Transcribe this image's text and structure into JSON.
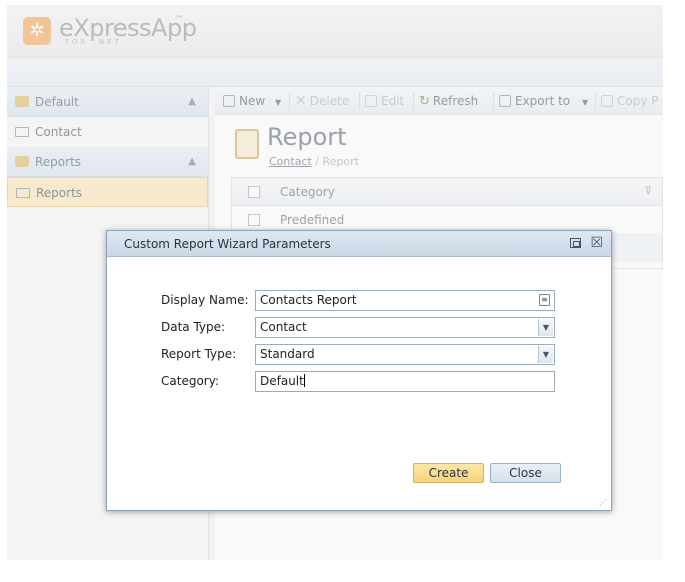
{
  "app": {
    "logo_name": "eXpressApp",
    "logo_tm": "™",
    "logo_sub": "FOR .NET"
  },
  "sidebar": {
    "groups": [
      {
        "label": "Default",
        "items": [
          {
            "label": "Contact"
          }
        ]
      },
      {
        "label": "Reports",
        "items": [
          {
            "label": "Reports",
            "selected": true
          }
        ]
      }
    ]
  },
  "toolbar": {
    "new": "New",
    "delete": "Delete",
    "edit": "Edit",
    "refresh": "Refresh",
    "export": "Export to",
    "copy": "Copy P"
  },
  "view": {
    "title": "Report",
    "breadcrumb_link": "Contact",
    "breadcrumb_sep": " / ",
    "breadcrumb_current": "Report",
    "grid_header": "Category",
    "grid_rows": [
      "Predefined"
    ]
  },
  "dialog": {
    "title": "Custom Report Wizard Parameters",
    "fields": {
      "display_name": {
        "label": "Display Name:",
        "value": "Contacts Report"
      },
      "data_type": {
        "label": "Data Type:",
        "value": "Contact"
      },
      "report_type": {
        "label": "Report Type:",
        "value": "Standard"
      },
      "category": {
        "label": "Category:",
        "value": "Default"
      }
    },
    "create": "Create",
    "close": "Close"
  },
  "colors": {
    "accent_logo": "#f3a24c",
    "selected_item": "#fbe2b0",
    "create_button": "#f5d279"
  }
}
